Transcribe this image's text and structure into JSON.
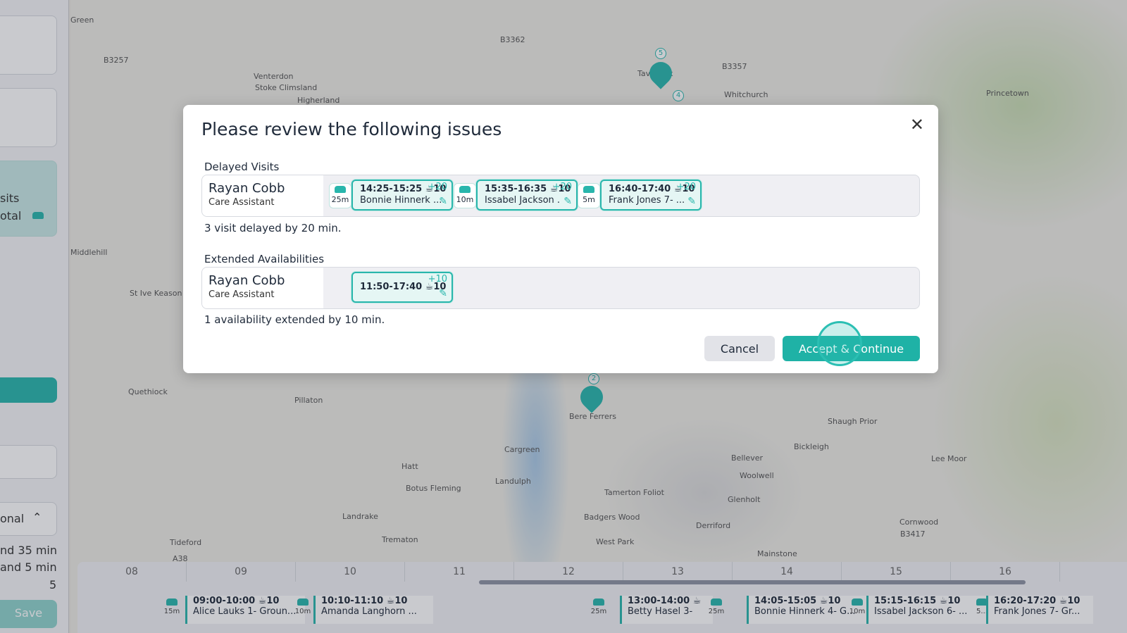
{
  "map": {
    "places": [
      "Green",
      "B3257",
      "Venterdon",
      "Stoke Climsland",
      "Higherland",
      "B3362",
      "Tavistock",
      "B3357",
      "Whitchurch",
      "Princetown",
      "Quethiock",
      "Pillaton",
      "Bere Ferrers",
      "Shaugh Prior",
      "Cargreen",
      "Bickleigh",
      "Lee Moor",
      "Bellever",
      "Woolwell",
      "Hatt",
      "Landulph",
      "Botus Fleming",
      "Tamerton Foliot",
      "Glenholt",
      "Landrake",
      "Badgers Wood",
      "Derriford",
      "Cornwood",
      "Tideford",
      "Trematon",
      "West Park",
      "Mainstone",
      "B3417",
      "A38",
      "St Ive Keason",
      "Middlehill"
    ],
    "markers": [
      "5",
      "4",
      "2"
    ]
  },
  "sidebar": {
    "texts": [
      "sits",
      "otal",
      "onal",
      "nd 35 min",
      "and 5 min",
      "5"
    ],
    "save": "Save"
  },
  "timeline": {
    "hours": [
      "08",
      "09",
      "10",
      "11",
      "12",
      "13",
      "14",
      "15",
      "16"
    ],
    "visits": [
      {
        "drive": "15m",
        "time": "09:00-10:00 ☕10",
        "name": "Alice Lauks 1- Groun..."
      },
      {
        "drive": "10m",
        "time": "10:10-11:10 ☕10",
        "name": "Amanda Langhorn ..."
      },
      {
        "drive": "25m",
        "time": "13:00-14:00 ☕",
        "name": "Betty Hasel 3-"
      },
      {
        "drive": "25m",
        "time": "14:05-15:05 ☕10",
        "name": "Bonnie Hinnerk 4- G..."
      },
      {
        "drive": "10m",
        "time": "15:15-16:15 ☕10",
        "name": "Issabel Jackson 6- ..."
      },
      {
        "drive": "5...",
        "time": "16:20-17:20 ☕10",
        "name": "Frank Jones 7- Gr..."
      }
    ]
  },
  "modal": {
    "title": "Please review the following issues",
    "delayed": {
      "heading": "Delayed Visits",
      "person": "Rayan Cobb",
      "role": "Care Assistant",
      "visits": [
        {
          "drive": "25m",
          "time": "14:25-15:25 ☕10",
          "delay": "+20",
          "name": "Bonnie Hinnerk ..."
        },
        {
          "drive": "10m",
          "time": "15:35-16:35 ☕10",
          "delay": "+20",
          "name": "Issabel Jackson ."
        },
        {
          "drive": "5m",
          "time": "16:40-17:40 ☕10",
          "delay": "+20",
          "name": "Frank Jones 7- ..."
        }
      ],
      "note": "3 visit delayed by 20 min."
    },
    "extended": {
      "heading": "Extended Availabilities",
      "person": "Rayan Cobb",
      "role": "Care Assistant",
      "availability": {
        "time": "11:50-17:40 ☕10",
        "extension": "+10"
      },
      "note": "1 availability extended by 10 min."
    },
    "cancel": "Cancel",
    "accept": "Accept & Continue"
  },
  "colors": {
    "accent": "#1fb2a6"
  }
}
